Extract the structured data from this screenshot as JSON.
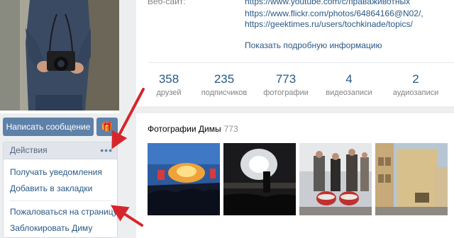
{
  "profile": {
    "write_message_label": "Написать сообщение",
    "gift_icon": "gift-icon"
  },
  "actions": {
    "header": "Действия",
    "more_icon": "more-dots-icon",
    "items": [
      {
        "label": "Получать уведомления"
      },
      {
        "label": "Добавить в закладки"
      },
      {
        "label": "Пожаловаться на страницу"
      },
      {
        "label": "Заблокировать Диму"
      }
    ]
  },
  "info": {
    "website_label": "Веб-сайт:",
    "links": [
      "https://www.youtube.com/c/правaживотных",
      "https://www.flickr.com/photos/64864166@N02/,",
      "https://geektimes.ru/users/tochkinade/topics/"
    ],
    "show_more": "Показать подробную информацию"
  },
  "stats": [
    {
      "value": "358",
      "label": "друзей"
    },
    {
      "value": "235",
      "label": "подписчиков"
    },
    {
      "value": "773",
      "label": "фотографии"
    },
    {
      "value": "4",
      "label": "видеозаписи"
    },
    {
      "value": "2",
      "label": "аудиозаписи"
    }
  ],
  "photos": {
    "title": "Фотографии Димы",
    "count": "773"
  },
  "colors": {
    "link": "#2a5885",
    "button": "#5e81a8",
    "arrow": "#d6262b",
    "page_bg": "#edeef0"
  }
}
